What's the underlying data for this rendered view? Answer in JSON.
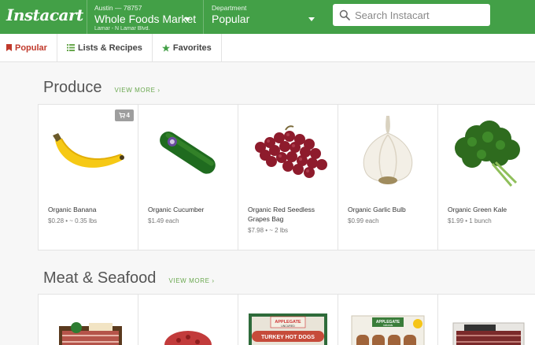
{
  "header": {
    "logo": "Instacart",
    "store": {
      "zip": "Austin — 78757",
      "name": "Whole Foods Market",
      "location": "Lamar - N Lamar Blvd."
    },
    "department": {
      "label": "Department",
      "value": "Popular"
    },
    "search": {
      "placeholder": "Search Instacart"
    }
  },
  "subnav": [
    {
      "label": "Popular",
      "icon": "bookmark-icon"
    },
    {
      "label": "Lists & Recipes",
      "icon": "list-icon"
    },
    {
      "label": "Favorites",
      "icon": "star-icon"
    }
  ],
  "sections": [
    {
      "title": "Produce",
      "view_more": "VIEW MORE ›",
      "cart_badge": "4",
      "items": [
        {
          "name": "Organic Banana",
          "price": "$0.28 • ~ 0.35 lbs"
        },
        {
          "name": "Organic Cucumber",
          "price": "$1.49 each"
        },
        {
          "name": "Organic Red Seedless Grapes Bag",
          "price": "$7.98 • ~ 2 lbs"
        },
        {
          "name": "Organic Garlic Bulb",
          "price": "$0.99 each"
        },
        {
          "name": "Organic Green Kale",
          "price": "$1.99 • 1 bunch"
        }
      ]
    },
    {
      "title": "Meat & Seafood",
      "view_more": "VIEW MORE ›",
      "items": [
        {
          "brand": ""
        },
        {
          "brand": ""
        },
        {
          "brand": "APPLEGATE",
          "label": "TURKEY HOT DOGS",
          "sub": "UNCURED"
        },
        {
          "brand": "APPLEGATE",
          "sub": "naturals"
        },
        {
          "brand": ""
        }
      ]
    }
  ],
  "colors": {
    "header_green": "#43a047",
    "active_red": "#c0392b",
    "link_green": "#6aa84f"
  }
}
